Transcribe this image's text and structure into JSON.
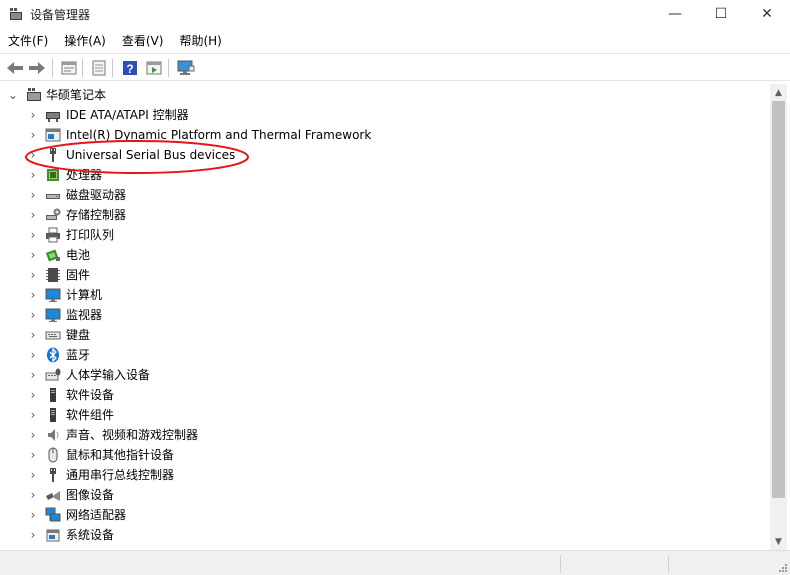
{
  "window": {
    "title": "设备管理器",
    "minimize_glyph": "—",
    "maximize_glyph": "☐",
    "close_glyph": "✕"
  },
  "menu": [
    {
      "label": "文件(F)"
    },
    {
      "label": "操作(A)"
    },
    {
      "label": "查看(V)"
    },
    {
      "label": "帮助(H)"
    }
  ],
  "toolbar": {
    "icons": [
      "back-arrow-icon",
      "forward-arrow-icon",
      "properties-icon",
      "update-driver-icon",
      "help-icon",
      "run-icon",
      "scan-hardware-icon"
    ]
  },
  "tree": {
    "root_label": "华硕笔记本",
    "root_expander": "⌄",
    "collapsed_glyph": "›",
    "items": [
      {
        "label": "IDE ATA/ATAPI 控制器",
        "icon": "ide-controller-icon"
      },
      {
        "label": "Intel(R) Dynamic Platform and Thermal Framework",
        "icon": "intel-framework-icon"
      },
      {
        "label": "Universal Serial Bus devices",
        "icon": "usb-plug-icon"
      },
      {
        "label": "处理器",
        "icon": "processor-icon"
      },
      {
        "label": "磁盘驱动器",
        "icon": "disk-drive-icon"
      },
      {
        "label": "存储控制器",
        "icon": "storage-controller-icon"
      },
      {
        "label": "打印队列",
        "icon": "printer-icon"
      },
      {
        "label": "电池",
        "icon": "battery-icon"
      },
      {
        "label": "固件",
        "icon": "firmware-icon"
      },
      {
        "label": "计算机",
        "icon": "computer-icon"
      },
      {
        "label": "监视器",
        "icon": "monitor-icon"
      },
      {
        "label": "键盘",
        "icon": "keyboard-icon"
      },
      {
        "label": "蓝牙",
        "icon": "bluetooth-icon"
      },
      {
        "label": "人体学输入设备",
        "icon": "hid-icon"
      },
      {
        "label": "软件设备",
        "icon": "software-device-icon"
      },
      {
        "label": "软件组件",
        "icon": "software-component-icon"
      },
      {
        "label": "声音、视频和游戏控制器",
        "icon": "speaker-icon"
      },
      {
        "label": "鼠标和其他指针设备",
        "icon": "mouse-icon"
      },
      {
        "label": "通用串行总线控制器",
        "icon": "usb-controller-icon"
      },
      {
        "label": "图像设备",
        "icon": "camera-icon"
      },
      {
        "label": "网络适配器",
        "icon": "network-adapter-icon"
      },
      {
        "label": "系统设备",
        "icon": "system-device-icon"
      }
    ]
  },
  "scrollbar": {
    "up_glyph": "▲",
    "down_glyph": "▼"
  },
  "colors": {
    "annotation": "#e8141c",
    "monitor_blue": "#1e88d8",
    "chip_green": "#4a8a2a",
    "bluetooth_blue": "#1670d8"
  }
}
